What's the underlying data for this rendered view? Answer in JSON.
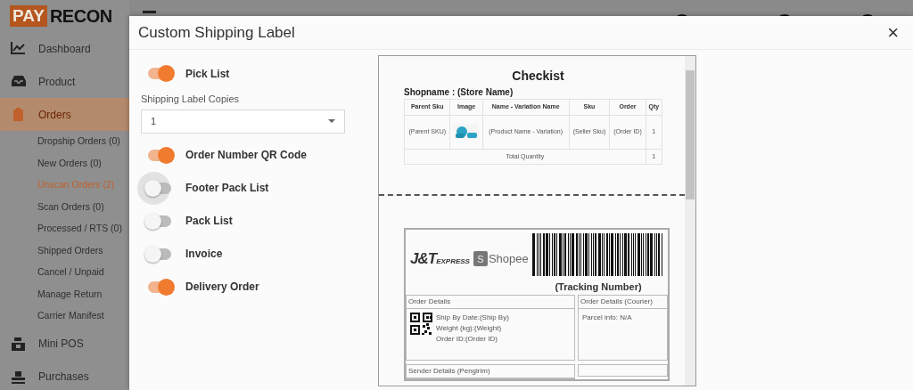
{
  "logo": {
    "left": "PAY",
    "right": "RECON"
  },
  "sidebar": {
    "items": [
      {
        "label": "Dashboard",
        "selected": false
      },
      {
        "label": "Product",
        "selected": false
      },
      {
        "label": "Orders",
        "selected": true,
        "children": [
          {
            "label": "Dropship Orders (0)",
            "selected": false
          },
          {
            "label": "New Orders (0)",
            "selected": false
          },
          {
            "label": "Unscan Orders (2)",
            "selected": true
          },
          {
            "label": "Scan Orders (0)",
            "selected": false
          },
          {
            "label": "Processed / RTS (0)",
            "selected": false
          },
          {
            "label": "Shipped Orders",
            "selected": false
          },
          {
            "label": "Cancel / Unpaid",
            "selected": false
          },
          {
            "label": "Manage Return",
            "selected": false
          },
          {
            "label": "Carrier Manifest",
            "selected": false
          }
        ]
      },
      {
        "label": "Mini POS",
        "selected": false
      },
      {
        "label": "Purchases",
        "selected": false
      }
    ]
  },
  "modal": {
    "title": "Custom Shipping Label",
    "close": "×",
    "options": [
      {
        "kind": "toggle",
        "label": "Pick List",
        "on": true
      },
      {
        "kind": "select",
        "label": "Shipping Label Copies",
        "value": "1"
      },
      {
        "kind": "toggle",
        "label": "Order Number QR Code",
        "on": true
      },
      {
        "kind": "toggle",
        "label": "Footer Pack List",
        "on": false,
        "focused": true
      },
      {
        "kind": "toggle",
        "label": "Pack List",
        "on": false
      },
      {
        "kind": "toggle",
        "label": "Invoice",
        "on": false
      },
      {
        "kind": "toggle",
        "label": "Delivery Order",
        "on": true
      }
    ],
    "preview": {
      "checklist": {
        "title": "Checkist",
        "shopname": "Shopname : (Store Name)",
        "columns": [
          "Parent Sku",
          "Image",
          "Name - Variation Name",
          "Sku",
          "Order",
          "Qty"
        ],
        "rows": [
          [
            "(Parent SKU)",
            {
              "kind": "picture"
            },
            "(Product Name - Variation)",
            "(Seller Sku)",
            "(Order ID)",
            "1"
          ]
        ],
        "total": {
          "label": "Total Quantity",
          "value": "1"
        }
      },
      "label": {
        "carrier_logo": "J&T",
        "carrier_logo_suffix": "EXPRESS",
        "shop_logo_mark": "S",
        "shop_logo": "Shopee",
        "tracking": "(Tracking Number)",
        "order_details": {
          "title": "Order Details",
          "lines": [
            "Ship By Date:(Ship By)",
            "Weight (kg):(Weight)",
            "Order ID:(Order ID)"
          ]
        },
        "courier_details": {
          "title": "Order Details (Courier)",
          "lines": [
            "Parcel info: N/A"
          ]
        },
        "sender_details": {
          "title": "Sender Details (Pengirim)"
        }
      }
    }
  }
}
